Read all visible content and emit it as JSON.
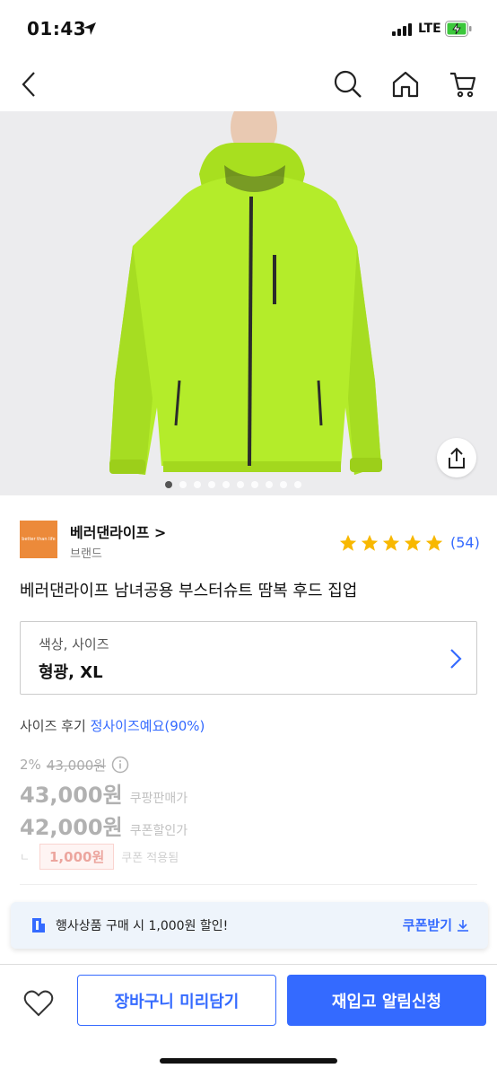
{
  "status": {
    "time": "01:43",
    "network": "LTE"
  },
  "nav": {
    "icons": [
      "back-icon",
      "search-icon",
      "home-icon",
      "cart-icon"
    ]
  },
  "hero": {
    "image_count": 10,
    "active_index": 0
  },
  "brand": {
    "name": "베러댄라이프 >",
    "sub": "브랜드",
    "logo_text": "better than life"
  },
  "rating": {
    "stars": 5,
    "count": "(54)"
  },
  "product": {
    "title": "베러댄라이프 남녀공용 부스터슈트 땀복 후드 집업"
  },
  "option": {
    "label": "색상, 사이즈",
    "value": "형광, XL"
  },
  "size_review": {
    "label": "사이즈 후기",
    "value": "정사이즈예요(90%)"
  },
  "prices": {
    "discount": "2%",
    "original": "43,000원",
    "sale_price": "43,000원",
    "sale_label": "쿠팡판매가",
    "coupon_price": "42,000원",
    "coupon_label": "쿠폰할인가",
    "corner": "ㄴ",
    "coupon_amount": "1,000원",
    "coupon_applied": "쿠폰 적용됨"
  },
  "promo": {
    "text": "행사상품 구매 시 1,000원 할인!",
    "link": "쿠폰받기"
  },
  "bottom": {
    "cart_label": "장바구니 미리담기",
    "notify_label": "재입고 알림신청"
  },
  "colors": {
    "accent": "#346aff",
    "jacket": "#b4ec2a",
    "star": "#f8b800"
  }
}
